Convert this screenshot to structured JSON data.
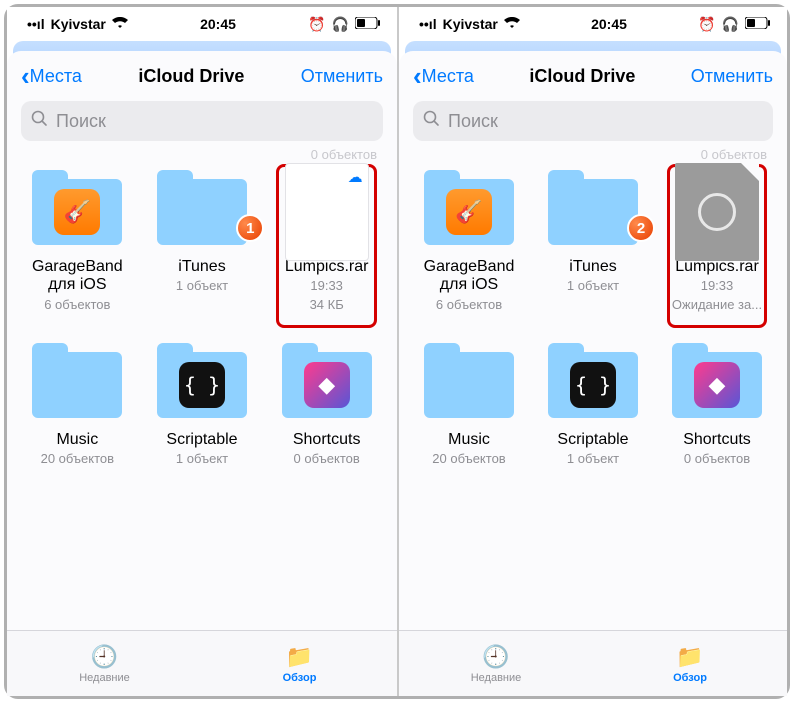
{
  "status": {
    "carrier": "Kyivstar",
    "time": "20:45"
  },
  "nav": {
    "back": "Места",
    "title": "iCloud Drive",
    "cancel": "Отменить"
  },
  "search": {
    "placeholder": "Поиск"
  },
  "topcount": "0 объектов",
  "tabs": {
    "recent": "Недавние",
    "browse": "Обзор"
  },
  "left": {
    "items": [
      {
        "name": "GarageBand для iOS",
        "sub": "6 объектов",
        "kind": "folder-gb"
      },
      {
        "name": "iTunes",
        "sub": "1 объект",
        "kind": "folder",
        "badge": "1"
      },
      {
        "name": "Lumpics.rar",
        "sub1": "19:33",
        "sub2": "34 КБ",
        "kind": "file-cloud",
        "highlight": true
      },
      {
        "name": "Music",
        "sub": "20 объектов",
        "kind": "folder"
      },
      {
        "name": "Scriptable",
        "sub": "1 объект",
        "kind": "folder-sc"
      },
      {
        "name": "Shortcuts",
        "sub": "0 объектов",
        "kind": "folder-shc"
      }
    ]
  },
  "right": {
    "items": [
      {
        "name": "GarageBand для iOS",
        "sub": "6 объектов",
        "kind": "folder-gb"
      },
      {
        "name": "iTunes",
        "sub": "1 объект",
        "kind": "folder",
        "badge": "2"
      },
      {
        "name": "Lumpics.rar",
        "sub1": "19:33",
        "sub2": "Ожидание за...",
        "kind": "file-loading",
        "highlight": true
      },
      {
        "name": "Music",
        "sub": "20 объектов",
        "kind": "folder"
      },
      {
        "name": "Scriptable",
        "sub": "1 объект",
        "kind": "folder-sc"
      },
      {
        "name": "Shortcuts",
        "sub": "0 объектов",
        "kind": "folder-shc"
      }
    ]
  }
}
